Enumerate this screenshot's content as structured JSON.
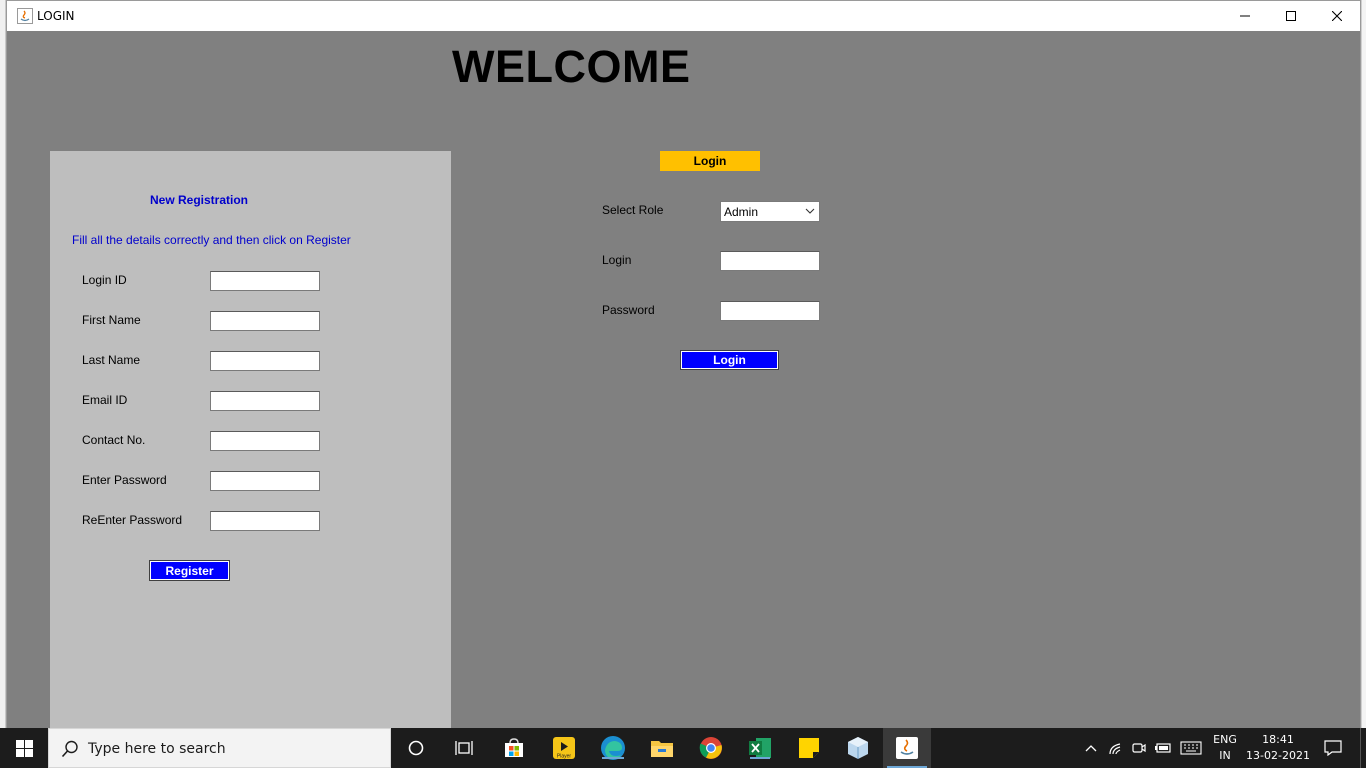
{
  "window": {
    "title": "LOGIN",
    "minimize_icon": "minimize-icon",
    "maximize_icon": "maximize-icon",
    "close_icon": "close-icon"
  },
  "header": {
    "welcome": "WELCOME"
  },
  "registration": {
    "title": "New Registration",
    "hint": "Fill all the details correctly and then click on Register",
    "fields": [
      {
        "label": "Login ID",
        "value": ""
      },
      {
        "label": "First Name",
        "value": ""
      },
      {
        "label": "Last Name",
        "value": ""
      },
      {
        "label": "Email ID",
        "value": ""
      },
      {
        "label": "Contact No.",
        "value": ""
      },
      {
        "label": "Enter Password",
        "value": ""
      },
      {
        "label": "ReEnter Password",
        "value": ""
      }
    ],
    "register_label": "Register"
  },
  "login": {
    "badge": "Login",
    "role_label": "Select Role",
    "role_value": "Admin",
    "login_label": "Login",
    "login_value": "",
    "password_label": "Password",
    "password_value": "",
    "button_label": "Login"
  },
  "taskbar": {
    "search_placeholder": "Type here to search",
    "apps": [
      "cortana-icon",
      "task-view-icon",
      "store-icon",
      "player-icon",
      "edge-icon",
      "file-explorer-icon",
      "chrome-icon",
      "excel-icon",
      "sticky-notes-icon",
      "virtualbox-icon",
      "java-icon"
    ],
    "player_badge": "Player",
    "language": "ENG",
    "region": "IN",
    "time": "18:41",
    "date": "13-02-2021"
  },
  "colors": {
    "window_bg": "#808080",
    "panel_bg": "#bebebe",
    "accent_blue": "#0000ff",
    "label_blue": "#0000cc",
    "badge_yellow": "#ffc000",
    "taskbar": "#1c1c1c"
  }
}
